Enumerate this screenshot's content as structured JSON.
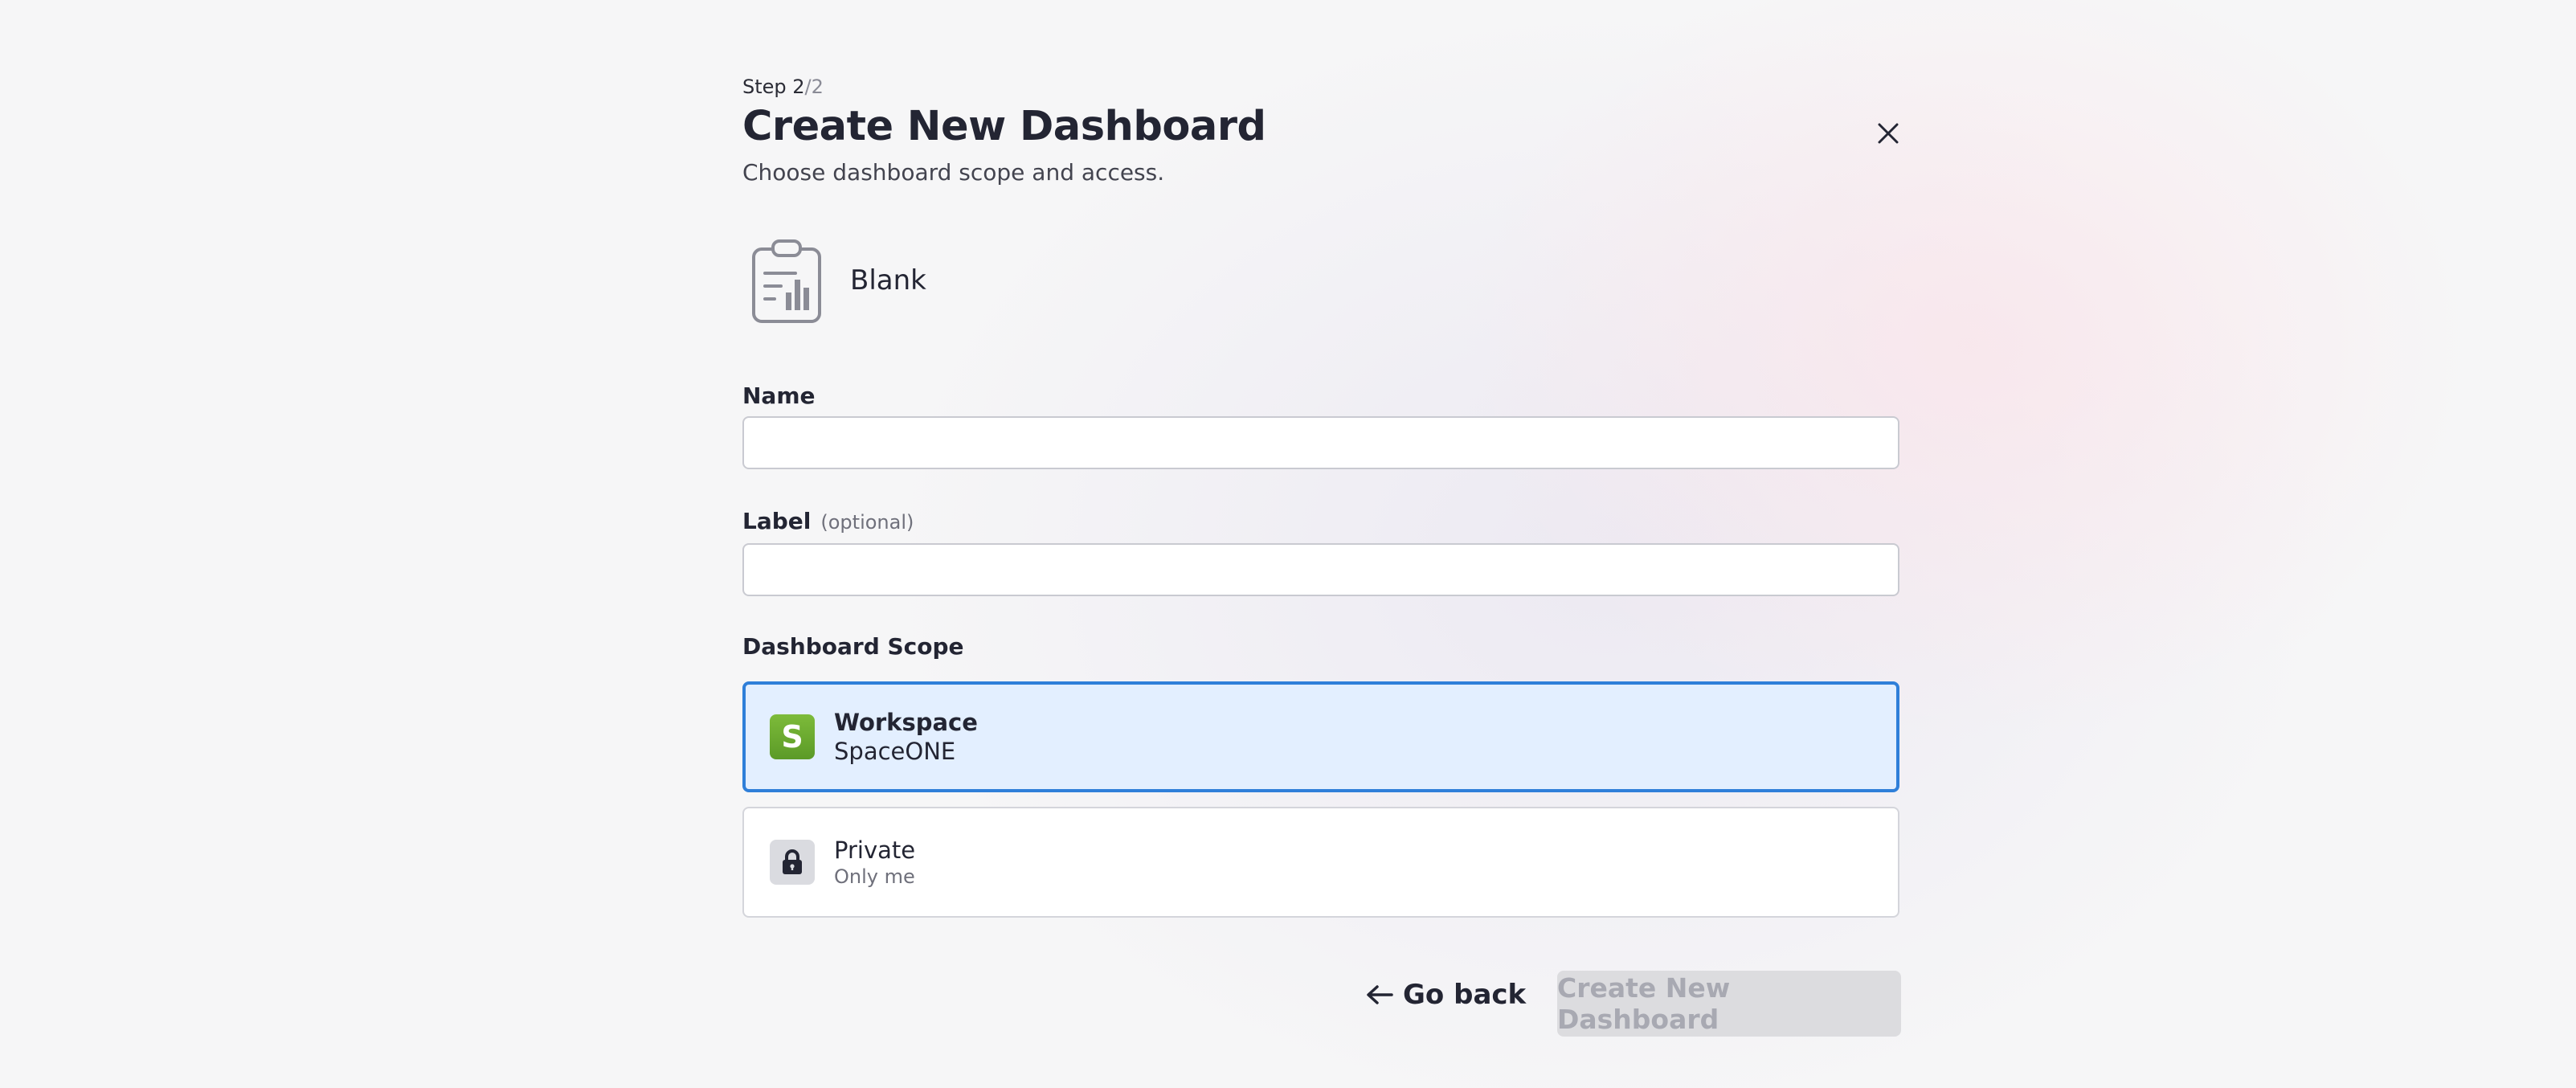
{
  "header": {
    "step_label": "Step 2",
    "step_total": "/2",
    "title": "Create New Dashboard",
    "subtitle": "Choose dashboard scope and access."
  },
  "template": {
    "icon": "clipboard-chart-icon",
    "name": "Blank"
  },
  "form": {
    "name_label": "Name",
    "name_value": "",
    "label_label": "Label",
    "label_optional": "(optional)",
    "label_value": "",
    "scope_label": "Dashboard Scope"
  },
  "scope_options": [
    {
      "badge": "S",
      "title": "Workspace",
      "subtitle": "SpaceONE",
      "selected": true,
      "badge_color": "#6aa832"
    },
    {
      "badge_icon": "lock-icon",
      "title": "Private",
      "subtitle": "Only me",
      "selected": false
    }
  ],
  "actions": {
    "back_label": "Go back",
    "create_label": "Create New Dashboard"
  },
  "colors": {
    "accent": "#2f7fd9",
    "selected_bg": "#e3efff",
    "disabled_button": "#dcdcdf"
  }
}
